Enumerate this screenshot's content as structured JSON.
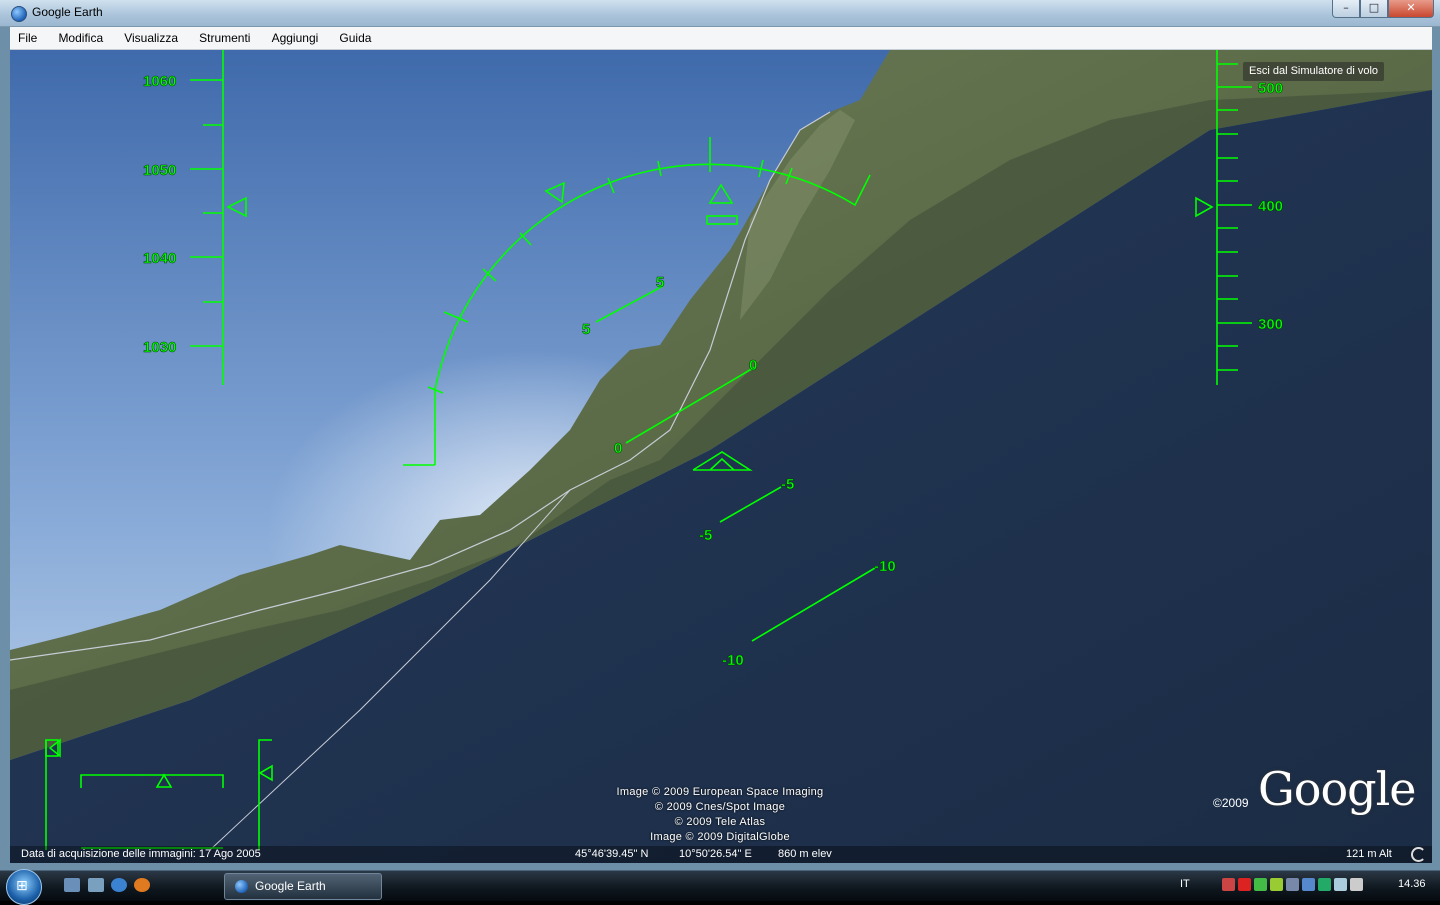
{
  "window": {
    "title": "Google Earth"
  },
  "menu": {
    "items": [
      "File",
      "Modifica",
      "Visualizza",
      "Strumenti",
      "Aggiungi",
      "Guida"
    ]
  },
  "hud": {
    "exit_label": "Esci dal Simulatore di volo",
    "altitude_scale": [
      "1060",
      "1050",
      "1040",
      "1030"
    ],
    "speed_scale": [
      "500",
      "400",
      "300"
    ],
    "pitch_labels": [
      "5",
      "0",
      "-5",
      "-10"
    ]
  },
  "credits": {
    "lines": [
      "Image © 2009 European Space Imaging",
      "© 2009 Cnes/Spot Image",
      "© 2009 Tele Atlas",
      "Image © 2009 DigitalGlobe"
    ],
    "logo": "Google",
    "logo_copyright": "©2009"
  },
  "status": {
    "date": "Data di acquisizione delle immagini: 17 Ago 2005",
    "lat": "45°46'39.45\" N",
    "lon": "10°50'26.54\" E",
    "elev": "860 m elev",
    "alt": "121 m Alt"
  },
  "taskbar": {
    "task_label": "Google Earth",
    "language": "IT",
    "clock": "14.36"
  },
  "colors": {
    "hud": "#00ff00",
    "sky_top": "#4a72b0",
    "water": "#203450"
  }
}
